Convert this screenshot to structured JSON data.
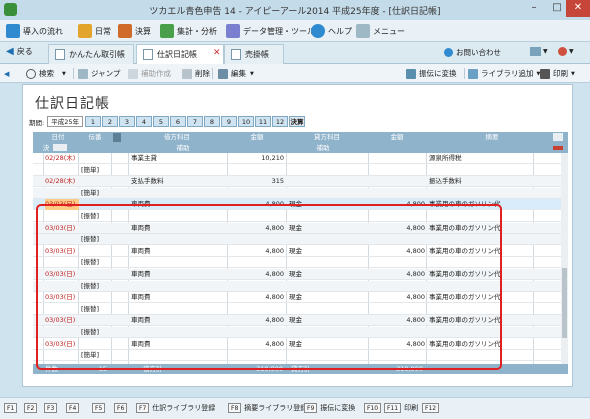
{
  "window": {
    "title": "ツカエル青色申告 14 - アイピーアール2014 平成25年度 - [仕訳日記帳]",
    "minimize": "–",
    "maximize": "□",
    "close": "✕"
  },
  "menu": {
    "items": [
      {
        "label": "導入の流れ",
        "icon": "flow-icon"
      },
      {
        "label": "日常",
        "icon": "daily-icon"
      },
      {
        "label": "決算",
        "icon": "settlement-icon"
      },
      {
        "label": "集計・分析",
        "icon": "analysis-icon"
      },
      {
        "label": "データ管理・ツール",
        "icon": "tools-icon"
      },
      {
        "label": "ヘルプ",
        "icon": "help-icon"
      },
      {
        "label": "メニュー",
        "icon": "menu-icon"
      }
    ]
  },
  "tabs": {
    "back": "戻る",
    "items": [
      "かんたん取引帳",
      "仕訳日記帳",
      "売掛帳"
    ],
    "active_index": 1,
    "inquiry": "お問い合わせ"
  },
  "toolbar": {
    "search": "検索",
    "jump": "ジャンプ",
    "assist": "補助作成",
    "delete": "削除",
    "edit": "編集",
    "transfer": "振伝に変換",
    "library_add": "ライブラリ追加",
    "print": "印刷"
  },
  "page": {
    "title": "仕訳日記帳",
    "period_label": "期間:",
    "period_value": "平成25年",
    "months": [
      "1",
      "2",
      "3",
      "4",
      "5",
      "6",
      "7",
      "8",
      "9",
      "10",
      "11",
      "12"
    ],
    "settle": "決算"
  },
  "grid": {
    "headers": {
      "date": "日付",
      "slip": "伝番",
      "debit_account": "借方科目",
      "debit_amount": "金額",
      "credit_account": "貸方科目",
      "credit_amount": "金額",
      "summary": "摘要",
      "settle": "決",
      "debit_sub": "補助",
      "credit_sub": "補助"
    },
    "rows": [
      {
        "date": "02/28(木)",
        "slip": "",
        "debit": "事業主貸",
        "damount": "10,210",
        "credit": "",
        "camount": "",
        "summary": "源泉所得税",
        "sub": ""
      },
      {
        "date": "",
        "slip": "[簡単]",
        "debit": "",
        "damount": "",
        "credit": "",
        "camount": "",
        "summary": "",
        "sub": ""
      },
      {
        "date": "02/28(木)",
        "slip": "",
        "debit": "支払手数料",
        "damount": "315",
        "credit": "",
        "camount": "",
        "summary": "振込手数料",
        "sub": ""
      },
      {
        "date": "",
        "slip": "[簡単]",
        "debit": "",
        "damount": "",
        "credit": "",
        "camount": "",
        "summary": "",
        "sub": ""
      },
      {
        "date": "03/03(日)",
        "slip": "",
        "debit": "車両費",
        "damount": "4,800",
        "credit": "現金",
        "camount": "4,800",
        "summary": "事業用の車のガソリン代",
        "sub": ""
      },
      {
        "date": "",
        "slip": "[振替]",
        "debit": "",
        "damount": "",
        "credit": "",
        "camount": "",
        "summary": "",
        "sub": ""
      },
      {
        "date": "03/03(日)",
        "slip": "",
        "debit": "車両費",
        "damount": "4,800",
        "credit": "現金",
        "camount": "4,800",
        "summary": "事業用の車のガソリン代",
        "sub": ""
      },
      {
        "date": "",
        "slip": "[振替]",
        "debit": "",
        "damount": "",
        "credit": "",
        "camount": "",
        "summary": "",
        "sub": ""
      },
      {
        "date": "03/03(日)",
        "slip": "",
        "debit": "車両費",
        "damount": "4,800",
        "credit": "現金",
        "camount": "4,800",
        "summary": "事業用の車のガソリン代",
        "sub": ""
      },
      {
        "date": "",
        "slip": "[振替]",
        "debit": "",
        "damount": "",
        "credit": "",
        "camount": "",
        "summary": "",
        "sub": ""
      },
      {
        "date": "03/03(日)",
        "slip": "",
        "debit": "車両費",
        "damount": "4,800",
        "credit": "現金",
        "camount": "4,800",
        "summary": "事業用の車のガソリン代",
        "sub": ""
      },
      {
        "date": "",
        "slip": "[振替]",
        "debit": "",
        "damount": "",
        "credit": "",
        "camount": "",
        "summary": "",
        "sub": ""
      },
      {
        "date": "03/03(日)",
        "slip": "",
        "debit": "車両費",
        "damount": "4,800",
        "credit": "現金",
        "camount": "4,800",
        "summary": "事業用の車のガソリン代",
        "sub": ""
      },
      {
        "date": "",
        "slip": "[振替]",
        "debit": "",
        "damount": "",
        "credit": "",
        "camount": "",
        "summary": "",
        "sub": ""
      },
      {
        "date": "03/03(日)",
        "slip": "",
        "debit": "車両費",
        "damount": "4,800",
        "credit": "現金",
        "camount": "4,800",
        "summary": "事業用の車のガソリン代",
        "sub": ""
      },
      {
        "date": "",
        "slip": "[振替]",
        "debit": "",
        "damount": "",
        "credit": "",
        "camount": "",
        "summary": "",
        "sub": ""
      },
      {
        "date": "03/03(日)",
        "slip": "",
        "debit": "車両費",
        "damount": "4,800",
        "credit": "現金",
        "camount": "4,800",
        "summary": "事業用の車のガソリン代",
        "sub": ""
      },
      {
        "date": "",
        "slip": "[簡単]",
        "debit": "",
        "damount": "",
        "credit": "",
        "camount": "",
        "summary": "",
        "sub": ""
      }
    ],
    "totals": {
      "count_label": "件数",
      "count": "15",
      "debit_label": "借方計",
      "debit_total": "319,900",
      "credit_label": "貸方計",
      "credit_total": "319,900"
    }
  },
  "fkeys": [
    {
      "key": "F1",
      "label": ""
    },
    {
      "key": "F2",
      "label": ""
    },
    {
      "key": "F3",
      "label": ""
    },
    {
      "key": "F4",
      "label": ""
    },
    {
      "key": "F5",
      "label": ""
    },
    {
      "key": "F6",
      "label": ""
    },
    {
      "key": "F7",
      "label": "仕訳ライブラリ登録"
    },
    {
      "key": "F8",
      "label": "摘要ライブラリ登録"
    },
    {
      "key": "F9",
      "label": "振伝に変換"
    },
    {
      "key": "F10",
      "label": ""
    },
    {
      "key": "F11",
      "label": "印刷"
    },
    {
      "key": "F12",
      "label": ""
    }
  ],
  "colors": {
    "accent": "#8fb3cb",
    "highlight": "#e02020",
    "date_red": "#c02020"
  }
}
